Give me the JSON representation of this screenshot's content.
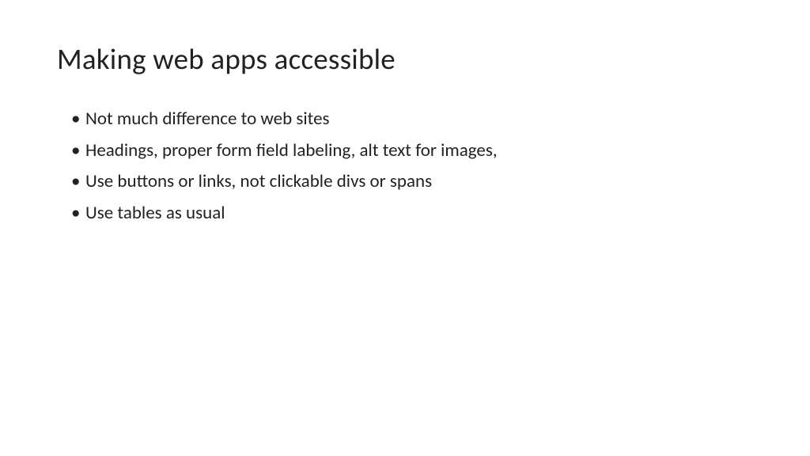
{
  "slide": {
    "title": "Making web apps accessible",
    "bullets": [
      "Not much difference to web sites",
      "Headings, proper form field labeling, alt text for images,",
      "Use buttons or links, not clickable divs or spans",
      "Use tables as usual"
    ]
  }
}
